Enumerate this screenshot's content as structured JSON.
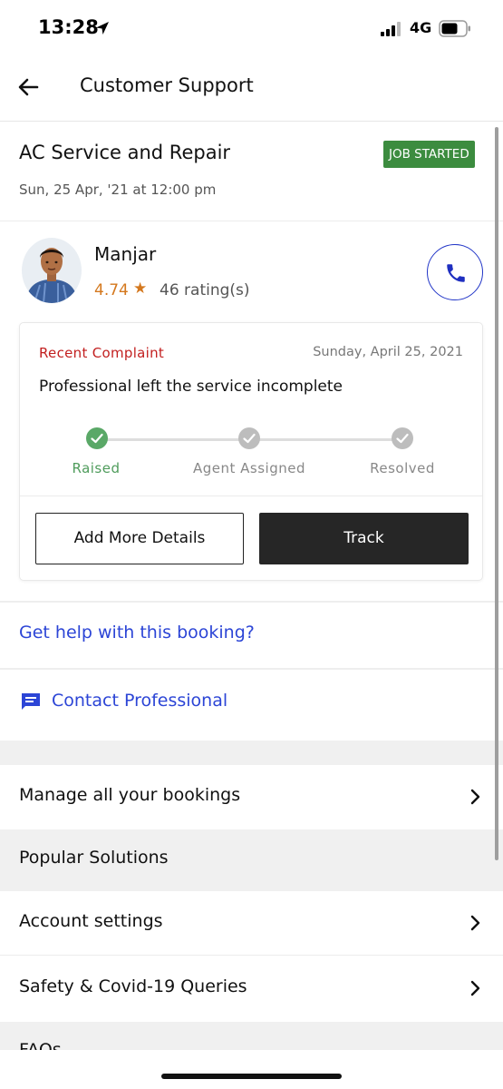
{
  "status_bar": {
    "time": "13:28",
    "network": "4G"
  },
  "header": {
    "title": "Customer Support",
    "back_icon": "arrow-left-icon"
  },
  "job": {
    "title": "AC Service and Repair",
    "date": "Sun, 25 Apr, '21 at 12:00 pm",
    "status_badge": "JOB STARTED",
    "badge_color": "#3c8c3f"
  },
  "professional": {
    "name": "Manjar",
    "rating": "4.74",
    "star": "★",
    "rating_count": "46 rating(s)",
    "call_icon": "phone-icon"
  },
  "complaint": {
    "label": "Recent Complaint",
    "date": "Sunday, April 25, 2021",
    "text": "Professional left the service incomplete",
    "steps": [
      {
        "label": "Raised",
        "done": true
      },
      {
        "label": "Agent Assigned",
        "done": false
      },
      {
        "label": "Resolved",
        "done": false
      }
    ],
    "add_details_label": "Add More Details",
    "track_label": "Track"
  },
  "help": {
    "booking_help": "Get help with this booking?",
    "contact_professional": "Contact Professional",
    "contact_icon": "chat-icon",
    "link_color": "#2c45d6"
  },
  "menu": {
    "manage_bookings": "Manage all your bookings",
    "popular_solutions": "Popular Solutions",
    "account_settings": "Account settings",
    "safety_covid": "Safety & Covid-19 Queries",
    "faq": "FAQs"
  }
}
